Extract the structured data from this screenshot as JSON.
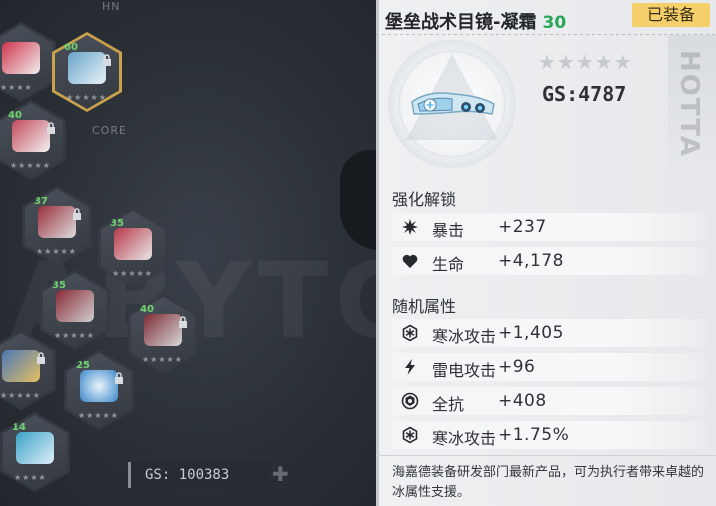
{
  "background": {
    "tags": {
      "hn": "HN",
      "core": "CORE"
    },
    "watermark": "ABYTCT",
    "hex_slots": [
      {
        "level": "",
        "item_color": "#d0344a"
      },
      {
        "level": "60",
        "item_color": "#6aa5c9"
      },
      {
        "level": "40",
        "item_color": "#c14a5a"
      },
      {
        "level": "37",
        "item_color": "#9a2f3c"
      },
      {
        "level": "35",
        "item_color": "#b8384a"
      },
      {
        "level": "35",
        "item_color": "#8a2a36"
      },
      {
        "level": "40",
        "item_color": "#7d2a34"
      },
      {
        "level": "",
        "item_color": "#4a78b8"
      },
      {
        "level": "25",
        "item_color": "#3a86c8"
      },
      {
        "level": "14",
        "item_color": "#3aa0c8"
      }
    ],
    "total_gs": "GS: 100383"
  },
  "panel": {
    "title": "堡垒战术目镜-凝霜",
    "level": "30",
    "equipped_badge": "已装备",
    "rarity_stars": "★★★★★",
    "gear_score": "GS:4787",
    "side_watermark": "HOTTA",
    "enhance_header": "强化解锁",
    "enhance_stats": [
      {
        "icon": "crit-icon",
        "name": "暴击",
        "value": "+237"
      },
      {
        "icon": "heart-icon",
        "name": "生命",
        "value": "+4,178"
      }
    ],
    "random_header": "随机属性",
    "random_stats": [
      {
        "icon": "frost-icon",
        "name": "寒冰攻击",
        "value": "+1,405"
      },
      {
        "icon": "lightning-icon",
        "name": "雷电攻击",
        "value": "+96"
      },
      {
        "icon": "shield-resist-icon",
        "name": "全抗",
        "value": "+408"
      },
      {
        "icon": "frost-icon",
        "name": "寒冰攻击",
        "value": "+1.75%"
      }
    ],
    "description": "海嘉德装备研发部门最新产品，可为执行者带来卓越的冰属性支援。"
  },
  "colors": {
    "level_green": "#2aa55a",
    "badge_yellow": "#f5d06a",
    "frost_blue": "#6fc3e8"
  }
}
